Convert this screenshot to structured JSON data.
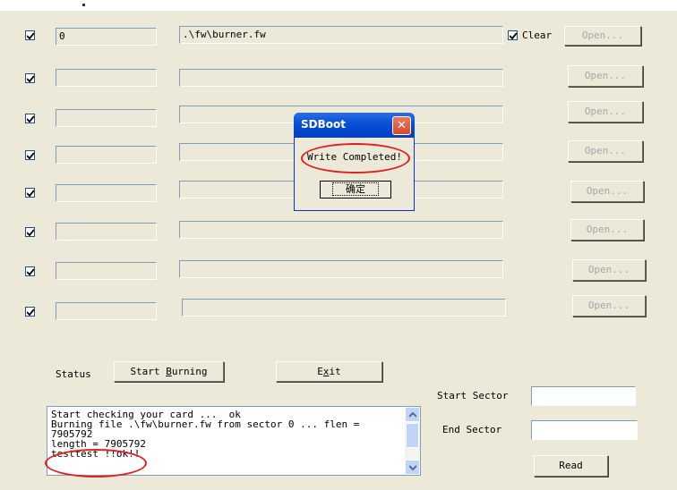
{
  "rows": [
    {
      "checked": true,
      "sector": "0",
      "file": ".\\fw\\burner.fw",
      "open_label": "Open..."
    },
    {
      "checked": true,
      "sector": "",
      "file": "",
      "open_label": "Open..."
    },
    {
      "checked": true,
      "sector": "",
      "file": "",
      "open_label": "Open..."
    },
    {
      "checked": true,
      "sector": "",
      "file": "",
      "open_label": "Open..."
    },
    {
      "checked": true,
      "sector": "",
      "file": "",
      "open_label": "Open..."
    },
    {
      "checked": true,
      "sector": "",
      "file": "",
      "open_label": "Open..."
    },
    {
      "checked": true,
      "sector": "",
      "file": "",
      "open_label": "Open..."
    },
    {
      "checked": true,
      "sector": "",
      "file": "",
      "open_label": "Open..."
    }
  ],
  "clear": {
    "checked": true,
    "label": "Clear"
  },
  "status_label": "Status",
  "start_burning": {
    "pre": "Start ",
    "accel": "B",
    "post": "urning"
  },
  "exit": {
    "pre": "E",
    "accel": "x",
    "post": "it"
  },
  "log": "Start checking your card ...  ok\nBurning file .\\fw\\burner.fw from sector 0 ... flen = 7905792\nlength = 7905792\ntesttest !!ok!!",
  "start_sector": {
    "label": "Start Sector",
    "value": ""
  },
  "end_sector": {
    "label": "End Sector",
    "value": ""
  },
  "read_label": "Read",
  "dialog": {
    "title": "SDBoot",
    "message": "Write Completed!",
    "ok_label": "确定"
  },
  "colors": {
    "face": "#ECE9D8",
    "titlebar": "#0a52d8",
    "highlight": "#e02020"
  }
}
